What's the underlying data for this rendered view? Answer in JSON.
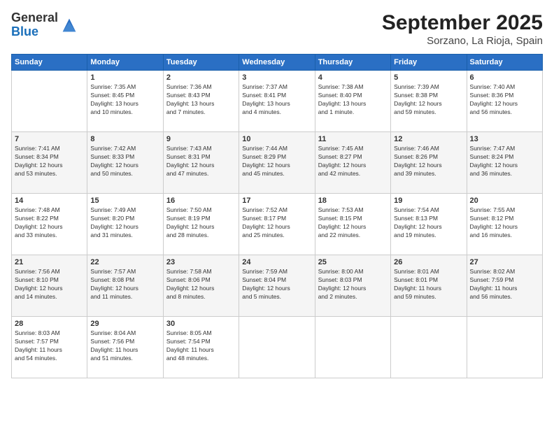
{
  "header": {
    "logo_line1": "General",
    "logo_line2": "Blue",
    "title": "September 2025",
    "subtitle": "Sorzano, La Rioja, Spain"
  },
  "columns": [
    "Sunday",
    "Monday",
    "Tuesday",
    "Wednesday",
    "Thursday",
    "Friday",
    "Saturday"
  ],
  "weeks": [
    [
      {
        "day": "",
        "info": ""
      },
      {
        "day": "1",
        "info": "Sunrise: 7:35 AM\nSunset: 8:45 PM\nDaylight: 13 hours\nand 10 minutes."
      },
      {
        "day": "2",
        "info": "Sunrise: 7:36 AM\nSunset: 8:43 PM\nDaylight: 13 hours\nand 7 minutes."
      },
      {
        "day": "3",
        "info": "Sunrise: 7:37 AM\nSunset: 8:41 PM\nDaylight: 13 hours\nand 4 minutes."
      },
      {
        "day": "4",
        "info": "Sunrise: 7:38 AM\nSunset: 8:40 PM\nDaylight: 13 hours\nand 1 minute."
      },
      {
        "day": "5",
        "info": "Sunrise: 7:39 AM\nSunset: 8:38 PM\nDaylight: 12 hours\nand 59 minutes."
      },
      {
        "day": "6",
        "info": "Sunrise: 7:40 AM\nSunset: 8:36 PM\nDaylight: 12 hours\nand 56 minutes."
      }
    ],
    [
      {
        "day": "7",
        "info": "Sunrise: 7:41 AM\nSunset: 8:34 PM\nDaylight: 12 hours\nand 53 minutes."
      },
      {
        "day": "8",
        "info": "Sunrise: 7:42 AM\nSunset: 8:33 PM\nDaylight: 12 hours\nand 50 minutes."
      },
      {
        "day": "9",
        "info": "Sunrise: 7:43 AM\nSunset: 8:31 PM\nDaylight: 12 hours\nand 47 minutes."
      },
      {
        "day": "10",
        "info": "Sunrise: 7:44 AM\nSunset: 8:29 PM\nDaylight: 12 hours\nand 45 minutes."
      },
      {
        "day": "11",
        "info": "Sunrise: 7:45 AM\nSunset: 8:27 PM\nDaylight: 12 hours\nand 42 minutes."
      },
      {
        "day": "12",
        "info": "Sunrise: 7:46 AM\nSunset: 8:26 PM\nDaylight: 12 hours\nand 39 minutes."
      },
      {
        "day": "13",
        "info": "Sunrise: 7:47 AM\nSunset: 8:24 PM\nDaylight: 12 hours\nand 36 minutes."
      }
    ],
    [
      {
        "day": "14",
        "info": "Sunrise: 7:48 AM\nSunset: 8:22 PM\nDaylight: 12 hours\nand 33 minutes."
      },
      {
        "day": "15",
        "info": "Sunrise: 7:49 AM\nSunset: 8:20 PM\nDaylight: 12 hours\nand 31 minutes."
      },
      {
        "day": "16",
        "info": "Sunrise: 7:50 AM\nSunset: 8:19 PM\nDaylight: 12 hours\nand 28 minutes."
      },
      {
        "day": "17",
        "info": "Sunrise: 7:52 AM\nSunset: 8:17 PM\nDaylight: 12 hours\nand 25 minutes."
      },
      {
        "day": "18",
        "info": "Sunrise: 7:53 AM\nSunset: 8:15 PM\nDaylight: 12 hours\nand 22 minutes."
      },
      {
        "day": "19",
        "info": "Sunrise: 7:54 AM\nSunset: 8:13 PM\nDaylight: 12 hours\nand 19 minutes."
      },
      {
        "day": "20",
        "info": "Sunrise: 7:55 AM\nSunset: 8:12 PM\nDaylight: 12 hours\nand 16 minutes."
      }
    ],
    [
      {
        "day": "21",
        "info": "Sunrise: 7:56 AM\nSunset: 8:10 PM\nDaylight: 12 hours\nand 14 minutes."
      },
      {
        "day": "22",
        "info": "Sunrise: 7:57 AM\nSunset: 8:08 PM\nDaylight: 12 hours\nand 11 minutes."
      },
      {
        "day": "23",
        "info": "Sunrise: 7:58 AM\nSunset: 8:06 PM\nDaylight: 12 hours\nand 8 minutes."
      },
      {
        "day": "24",
        "info": "Sunrise: 7:59 AM\nSunset: 8:04 PM\nDaylight: 12 hours\nand 5 minutes."
      },
      {
        "day": "25",
        "info": "Sunrise: 8:00 AM\nSunset: 8:03 PM\nDaylight: 12 hours\nand 2 minutes."
      },
      {
        "day": "26",
        "info": "Sunrise: 8:01 AM\nSunset: 8:01 PM\nDaylight: 11 hours\nand 59 minutes."
      },
      {
        "day": "27",
        "info": "Sunrise: 8:02 AM\nSunset: 7:59 PM\nDaylight: 11 hours\nand 56 minutes."
      }
    ],
    [
      {
        "day": "28",
        "info": "Sunrise: 8:03 AM\nSunset: 7:57 PM\nDaylight: 11 hours\nand 54 minutes."
      },
      {
        "day": "29",
        "info": "Sunrise: 8:04 AM\nSunset: 7:56 PM\nDaylight: 11 hours\nand 51 minutes."
      },
      {
        "day": "30",
        "info": "Sunrise: 8:05 AM\nSunset: 7:54 PM\nDaylight: 11 hours\nand 48 minutes."
      },
      {
        "day": "",
        "info": ""
      },
      {
        "day": "",
        "info": ""
      },
      {
        "day": "",
        "info": ""
      },
      {
        "day": "",
        "info": ""
      }
    ]
  ]
}
